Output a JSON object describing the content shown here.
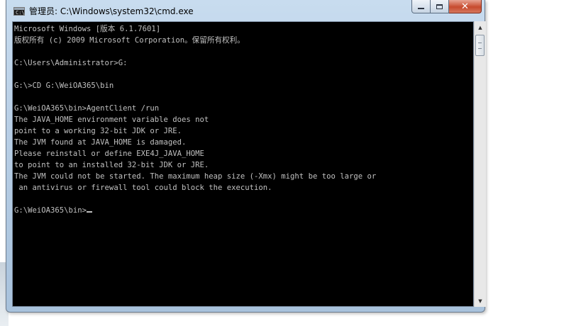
{
  "window": {
    "title": "管理员: C:\\Windows\\system32\\cmd.exe",
    "icon": "cmd-icon",
    "icon_text": "C:\\"
  },
  "controls": {
    "minimize_icon": "minimize-icon",
    "maximize_icon": "maximize-icon",
    "close_icon": "close-icon",
    "close_glyph": "✕"
  },
  "console": {
    "lines": [
      "Microsoft Windows [版本 6.1.7601]",
      "版权所有 (c) 2009 Microsoft Corporation。保留所有权利。",
      "",
      "C:\\Users\\Administrator>G:",
      "",
      "G:\\>CD G:\\WeiOA365\\bin",
      "",
      "G:\\WeiOA365\\bin>AgentClient /run",
      "The JAVA_HOME environment variable does not",
      "point to a working 32-bit JDK or JRE.",
      "The JVM found at JAVA_HOME is damaged.",
      "Please reinstall or define EXE4J_JAVA_HOME",
      "to point to an installed 32-bit JDK or JRE.",
      "The JVM could not be started. The maximum heap size (-Xmx) might be too large or",
      " an antivirus or firewall tool could block the execution.",
      "",
      "G:\\WeiOA365\\bin>"
    ]
  },
  "scrollbar": {
    "up_glyph": "▲",
    "down_glyph": "▼"
  },
  "colors": {
    "console_bg": "#000000",
    "console_text": "#c0c0c0",
    "close_button": "#c74a2e"
  }
}
